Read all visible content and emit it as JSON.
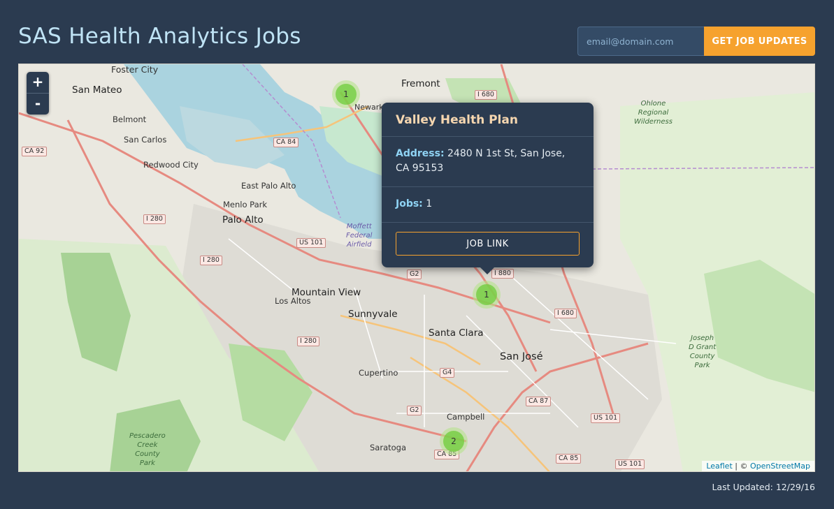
{
  "header": {
    "title": "SAS Health Analytics Jobs",
    "email_placeholder": "email@domain.com",
    "subscribe_label": "GET JOB UPDATES"
  },
  "map": {
    "zoom_in": "+",
    "zoom_out": "-",
    "clusters": [
      "1",
      "1",
      "2"
    ],
    "places": {
      "foster_city": "Foster City",
      "san_mateo": "San Mateo",
      "fremont": "Fremont",
      "newark": "Newark",
      "belmont": "Belmont",
      "san_carlos": "San Carlos",
      "redwood_city": "Redwood City",
      "east_palo_alto": "East Palo Alto",
      "menlo_park": "Menlo Park",
      "palo_alto": "Palo Alto",
      "mountain_view": "Mountain View",
      "los_altos": "Los Altos",
      "sunnyvale": "Sunnyvale",
      "santa_clara": "Santa Clara",
      "san_jose": "San José",
      "cupertino": "Cupertino",
      "campbell": "Campbell",
      "saratoga": "Saratoga",
      "moffett": "Moffett\nFederal\nAirfield",
      "ohlone": "Ohlone\nRegional\nWilderness",
      "grant": "Joseph\nD Grant\nCounty\nPark",
      "pescadero": "Pescadero\nCreek\nCounty\nPark"
    },
    "shields": [
      "I 680",
      "CA 84",
      "CA 92",
      "I 280",
      "I 280",
      "US 101",
      "I 880",
      "I 680",
      "I 280",
      "CA 87",
      "US 101",
      "CA 85",
      "CA 85",
      "US 101",
      "G2",
      "G2",
      "G4"
    ],
    "attribution": {
      "leaflet": "Leaflet",
      "separator": " | © ",
      "osm": "OpenStreetMap"
    }
  },
  "popup": {
    "title": "Valley Health Plan",
    "address_label": "Address:",
    "address": "2480 N 1st St, San Jose, CA 95153",
    "jobs_label": "Jobs:",
    "jobs": "1",
    "button_label": "JOB LINK"
  },
  "footer": {
    "updated": "Last Updated: 12/29/16"
  },
  "colors": {
    "background": "#2b3b50",
    "title": "#bfe3f5",
    "accent": "#f6a22e",
    "popup_title": "#f7d7b0",
    "popup_label": "#8fd3f4"
  }
}
